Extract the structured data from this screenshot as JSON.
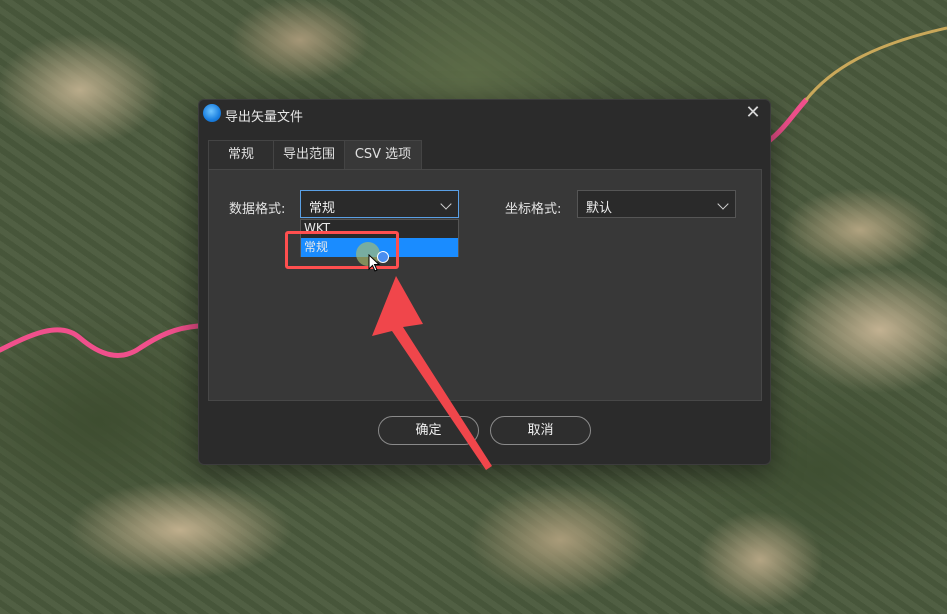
{
  "dialog": {
    "title": "导出矢量文件",
    "close_symbol": "✕",
    "tabs": [
      {
        "label": "常规"
      },
      {
        "label": "导出范围"
      },
      {
        "label": "CSV 选项"
      }
    ],
    "active_tab": "CSV 选项",
    "data_format": {
      "label": "数据格式:",
      "value": "常规",
      "options": [
        "WKT",
        "常规"
      ],
      "highlighted_option": "常规"
    },
    "coord_format": {
      "label": "坐标格式:",
      "value": "默认"
    },
    "buttons": {
      "ok": "确定",
      "cancel": "取消"
    }
  },
  "colors": {
    "dialog_bg": "#2b2b2b",
    "panel_bg": "#383838",
    "selection": "#1a8cff",
    "annotation_red": "#ff4f4f",
    "road_pink": "#f0508c"
  },
  "icons": [
    "app-logo-icon",
    "close-icon",
    "chevron-down-icon",
    "mouse-pointer-icon",
    "annotation-arrow-icon"
  ]
}
